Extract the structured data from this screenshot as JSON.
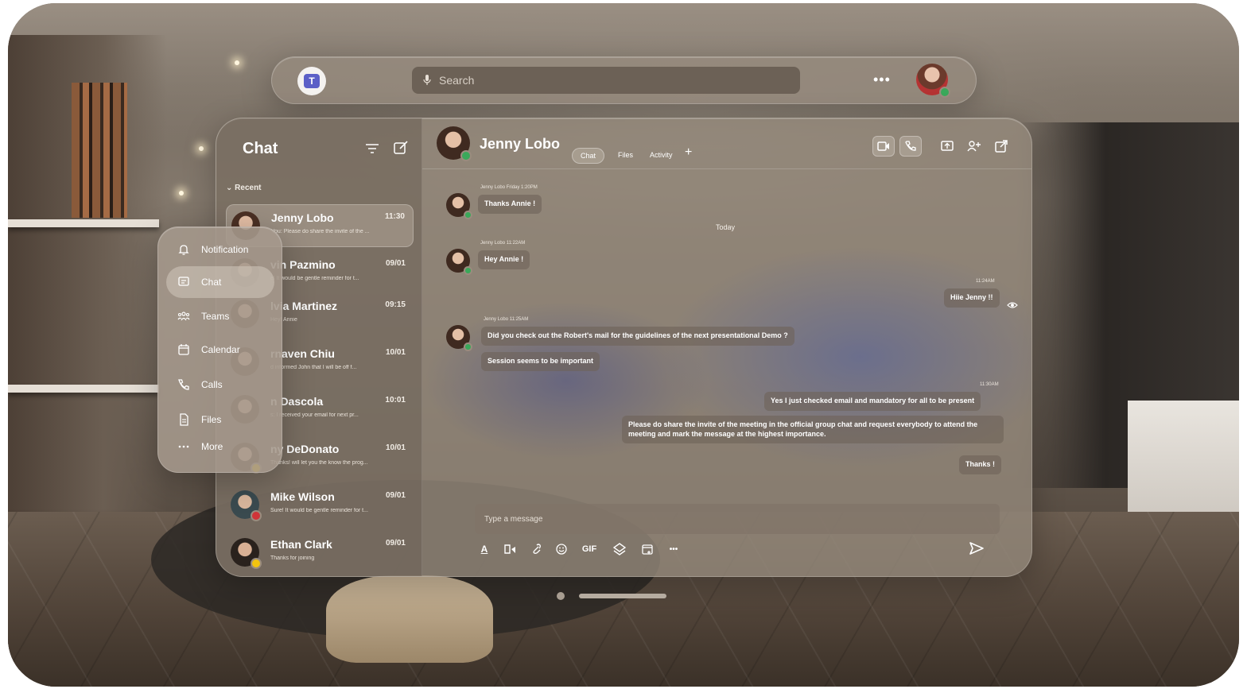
{
  "topbar": {
    "app_logo_icon": "teams-logo-icon",
    "search_placeholder": "Search",
    "more_label": "•••",
    "user_avatar_icon": "user-avatar"
  },
  "chat_list": {
    "title": "Chat",
    "section_label": "Recent",
    "items": [
      {
        "name": "Jenny Lobo",
        "time": "11:30",
        "preview": "You: Please do share the invite of the ...",
        "presence": "none"
      },
      {
        "name": "vin Pazmino",
        "time": "09/01",
        "preview": "el It would be gentle reminder for t...",
        "presence": "none"
      },
      {
        "name": "lvia Martinez",
        "time": "09:15",
        "preview": "Hey! Annie",
        "presence": "none"
      },
      {
        "name": "rnaven Chiu",
        "time": "10/01",
        "preview": "d informed John that I will be off f...",
        "presence": "none"
      },
      {
        "name": "n Dascola",
        "time": "10:01",
        "preview": "s: I received your email for next pr...",
        "presence": "none"
      },
      {
        "name": "ny DeDonato",
        "time": "10/01",
        "preview": "Thanks! will let you the know the prog...",
        "presence": "yellow"
      },
      {
        "name": "Mike Wilson",
        "time": "09/01",
        "preview": "Sure! It would be gentle reminder for t...",
        "presence": "red"
      },
      {
        "name": "Ethan Clark",
        "time": "09/01",
        "preview": "Thanks for joining",
        "presence": "yellow"
      }
    ]
  },
  "nav": {
    "items": [
      {
        "label": "Notification",
        "icon": "bell-icon"
      },
      {
        "label": "Chat",
        "icon": "chat-icon"
      },
      {
        "label": "Teams",
        "icon": "teams-icon"
      },
      {
        "label": "Calendar",
        "icon": "calendar-icon"
      },
      {
        "label": "Calls",
        "icon": "phone-icon"
      },
      {
        "label": "Files",
        "icon": "file-icon"
      },
      {
        "label": "More",
        "icon": "more-icon"
      }
    ],
    "active": "Chat"
  },
  "conversation": {
    "contact_name": "Jenny Lobo",
    "tabs": [
      "Chat",
      "Files",
      "Activity"
    ],
    "active_tab": "Chat",
    "add_tab_label": "+",
    "header_actions": [
      "video-call-icon",
      "audio-call-icon",
      "share-screen-icon",
      "add-people-icon",
      "pop-out-icon"
    ],
    "day_separator": "Today",
    "messages": [
      {
        "sender": "Jenny Lobo",
        "meta": "Jenny Lobo  Friday  1:20PM",
        "text": "Thanks Annie !",
        "side": "left"
      },
      {
        "sender": "Jenny Lobo",
        "meta": "Jenny Lobo  11:22AM",
        "text": "Hey Annie !",
        "side": "left"
      },
      {
        "sender": "me",
        "meta": "11:24AM",
        "text": "Hiie Jenny !!",
        "side": "right"
      },
      {
        "sender": "Jenny Lobo",
        "meta": "Jenny Lobo  11:25AM",
        "text": "Did you check out the Robert's mail for the guidelines of the next presentational Demo ?",
        "side": "left"
      },
      {
        "sender": "Jenny Lobo",
        "meta": "",
        "text": "Session seems to be important",
        "side": "left"
      },
      {
        "sender": "me",
        "meta": "11:30AM",
        "text": "Yes I just checked email and mandatory for all to be present",
        "side": "right"
      },
      {
        "sender": "me",
        "meta": "",
        "text": "Please do share the invite of the meeting in the official group chat and request everybody to attend the meeting and mark the message at the highest importance.",
        "side": "right"
      },
      {
        "sender": "me",
        "meta": "",
        "text": "Thanks !",
        "side": "right"
      }
    ],
    "composer_placeholder": "Type a message",
    "toolbar": [
      "format-icon",
      "highlight-icon",
      "attach-icon",
      "emoji-icon",
      "GIF",
      "sticker-icon",
      "schedule-icon",
      "more-icon"
    ],
    "gif_label": "GIF",
    "more_label": "•••"
  },
  "colors": {
    "teams_purple": "#5b5fc7",
    "presence_green": "#3aa85a",
    "presence_red": "#d13438",
    "presence_yellow": "#f2c40f"
  }
}
